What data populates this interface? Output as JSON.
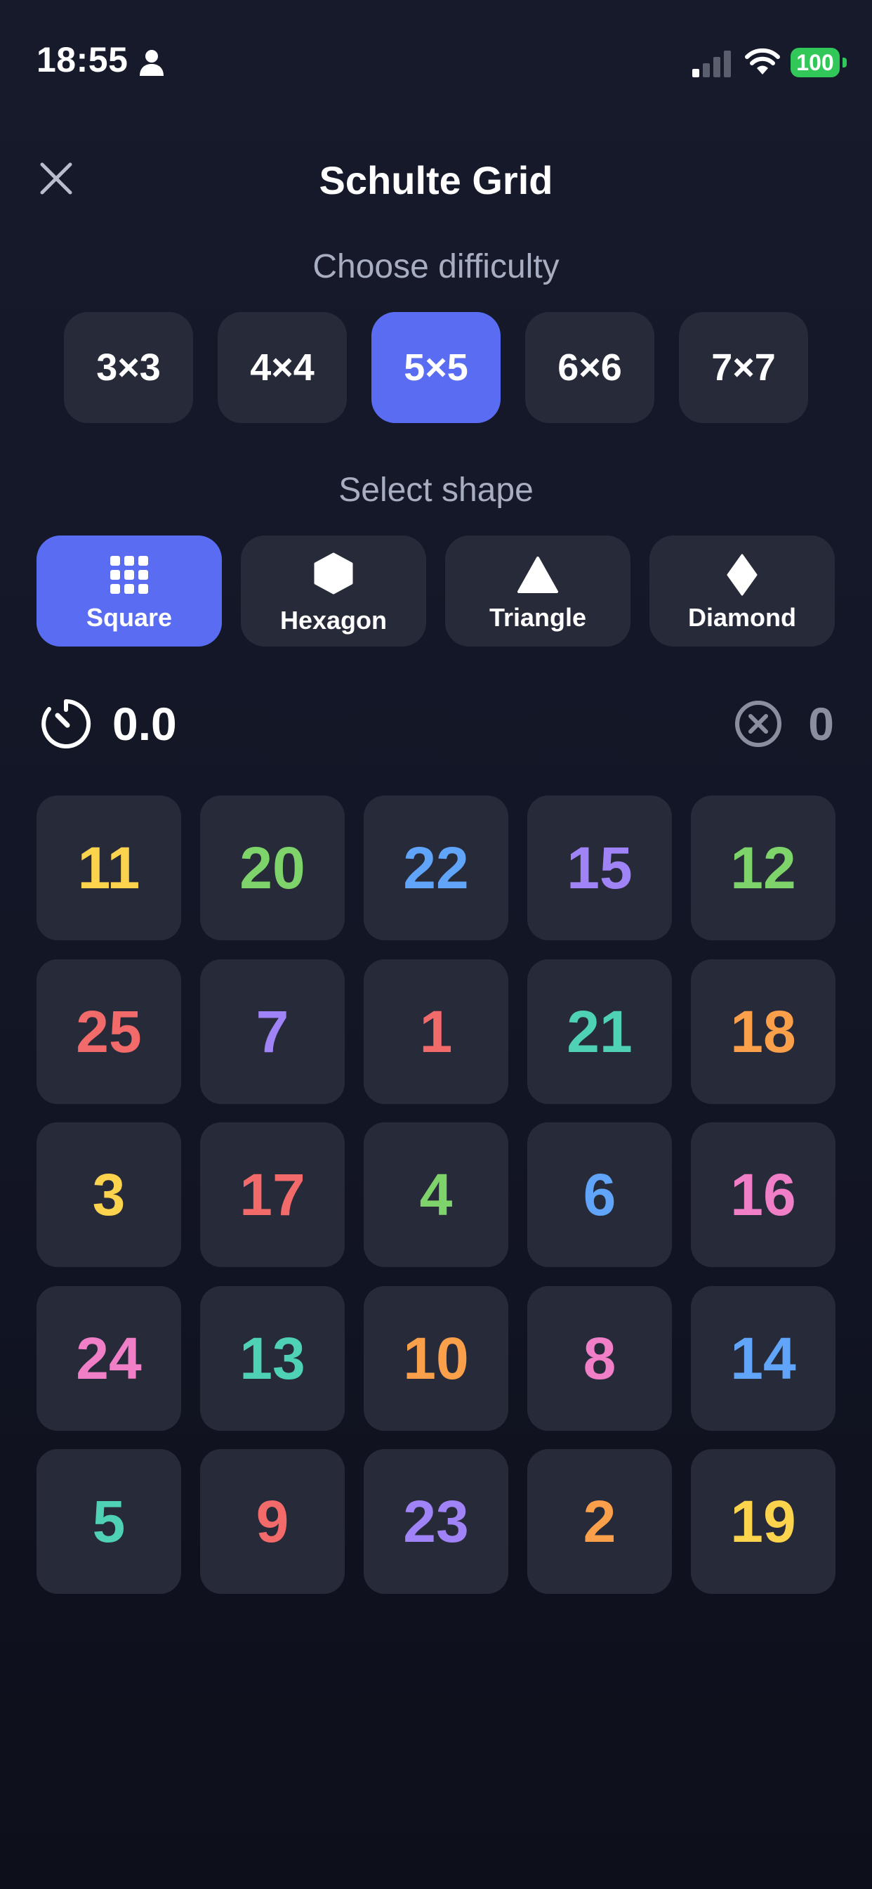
{
  "status_bar": {
    "time": "18:55",
    "battery": "100",
    "icons": [
      "person-icon",
      "cellular-signal-icon",
      "wifi-icon",
      "battery-icon"
    ]
  },
  "header": {
    "title": "Schulte Grid",
    "close_icon": "close-icon"
  },
  "difficulty": {
    "label": "Choose difficulty",
    "options": [
      "3×3",
      "4×4",
      "5×5",
      "6×6",
      "7×7"
    ],
    "selected": "5×5"
  },
  "shape": {
    "label": "Select shape",
    "options": [
      {
        "label": "Square",
        "icon": "grid-icon"
      },
      {
        "label": "Hexagon",
        "icon": "hexagon-icon"
      },
      {
        "label": "Triangle",
        "icon": "triangle-icon"
      },
      {
        "label": "Diamond",
        "icon": "diamond-icon"
      }
    ],
    "selected": "Square"
  },
  "stats": {
    "timer": "0.0",
    "timer_icon": "stopwatch-icon",
    "errors": "0",
    "errors_icon": "x-circle-icon"
  },
  "grid": {
    "rows": [
      [
        {
          "n": "11",
          "color": "yellow"
        },
        {
          "n": "20",
          "color": "green"
        },
        {
          "n": "22",
          "color": "blue"
        },
        {
          "n": "15",
          "color": "purple"
        },
        {
          "n": "12",
          "color": "green"
        }
      ],
      [
        {
          "n": "25",
          "color": "red"
        },
        {
          "n": "7",
          "color": "purple"
        },
        {
          "n": "1",
          "color": "red"
        },
        {
          "n": "21",
          "color": "teal"
        },
        {
          "n": "18",
          "color": "orange"
        }
      ],
      [
        {
          "n": "3",
          "color": "yellow"
        },
        {
          "n": "17",
          "color": "red"
        },
        {
          "n": "4",
          "color": "green"
        },
        {
          "n": "6",
          "color": "blue"
        },
        {
          "n": "16",
          "color": "pink"
        }
      ],
      [
        {
          "n": "24",
          "color": "pink"
        },
        {
          "n": "13",
          "color": "teal"
        },
        {
          "n": "10",
          "color": "orange"
        },
        {
          "n": "8",
          "color": "pink"
        },
        {
          "n": "14",
          "color": "blue"
        }
      ],
      [
        {
          "n": "5",
          "color": "teal"
        },
        {
          "n": "9",
          "color": "red"
        },
        {
          "n": "23",
          "color": "purple"
        },
        {
          "n": "2",
          "color": "orange"
        },
        {
          "n": "19",
          "color": "yellow"
        }
      ]
    ]
  },
  "colors": {
    "accent": "#5a6df2",
    "tile": "#272a39",
    "background": "#141726",
    "yellow": "#fcd34d",
    "green": "#7ed36b",
    "blue": "#60a5fa",
    "purple": "#a084f7",
    "red": "#f26a6a",
    "teal": "#4fd1b5",
    "orange": "#fba04a",
    "pink": "#f07fc8",
    "battery": "#32c759"
  }
}
